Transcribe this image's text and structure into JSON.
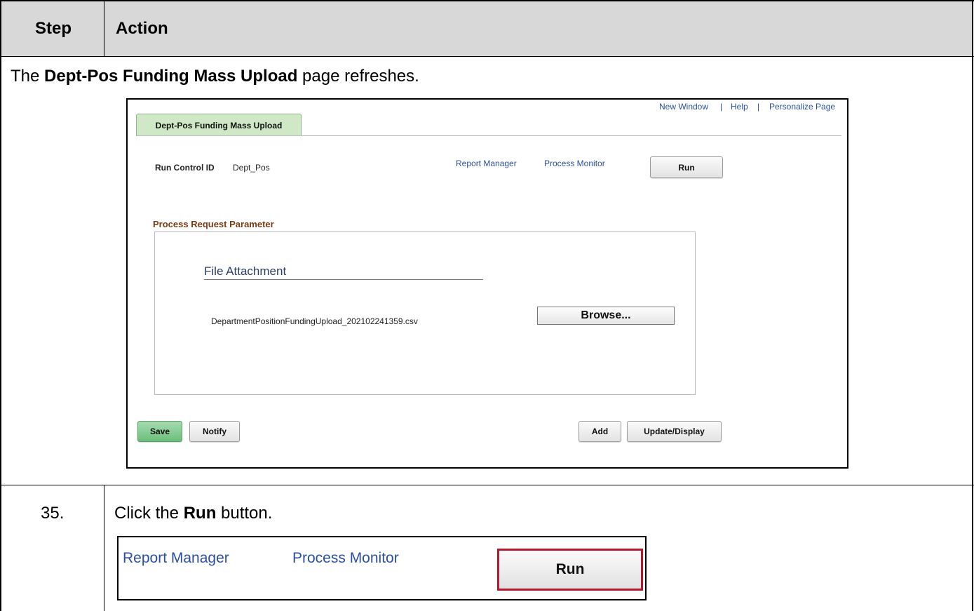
{
  "table": {
    "header_step": "Step",
    "header_action": "Action",
    "intro_prefix": "The ",
    "intro_bold": "Dept-Pos Funding Mass Upload",
    "intro_suffix": " page refreshes.",
    "step_number": "35.",
    "instruction_prefix": "Click the ",
    "instruction_bold": "Run",
    "instruction_suffix": " button."
  },
  "peoplesoft": {
    "top_links": [
      "New Window",
      "Help",
      "Personalize Page"
    ],
    "separator": "|",
    "tab_label": "Dept-Pos Funding Mass Upload",
    "run_control_label": "Run Control ID",
    "run_control_value": "Dept_Pos",
    "report_manager": "Report Manager",
    "process_monitor": "Process Monitor",
    "run_button": "Run",
    "section_title": "Process Request Parameter",
    "file_attachment_title": "File Attachment",
    "file_name": "DepartmentPositionFundingUpload_202102241359.csv",
    "browse_button": "Browse...",
    "save_button": "Save",
    "notify_button": "Notify",
    "add_button": "Add",
    "update_display_button": "Update/Display"
  },
  "zoom": {
    "report_manager": "Report Manager",
    "process_monitor": "Process Monitor",
    "run_button": "Run"
  },
  "colors": {
    "link": "#2b4ea0",
    "header_bg": "#d8d8d8",
    "highlight": "#b8162c",
    "save_green": "#6bbf7c",
    "section_title": "#7a3a14"
  }
}
